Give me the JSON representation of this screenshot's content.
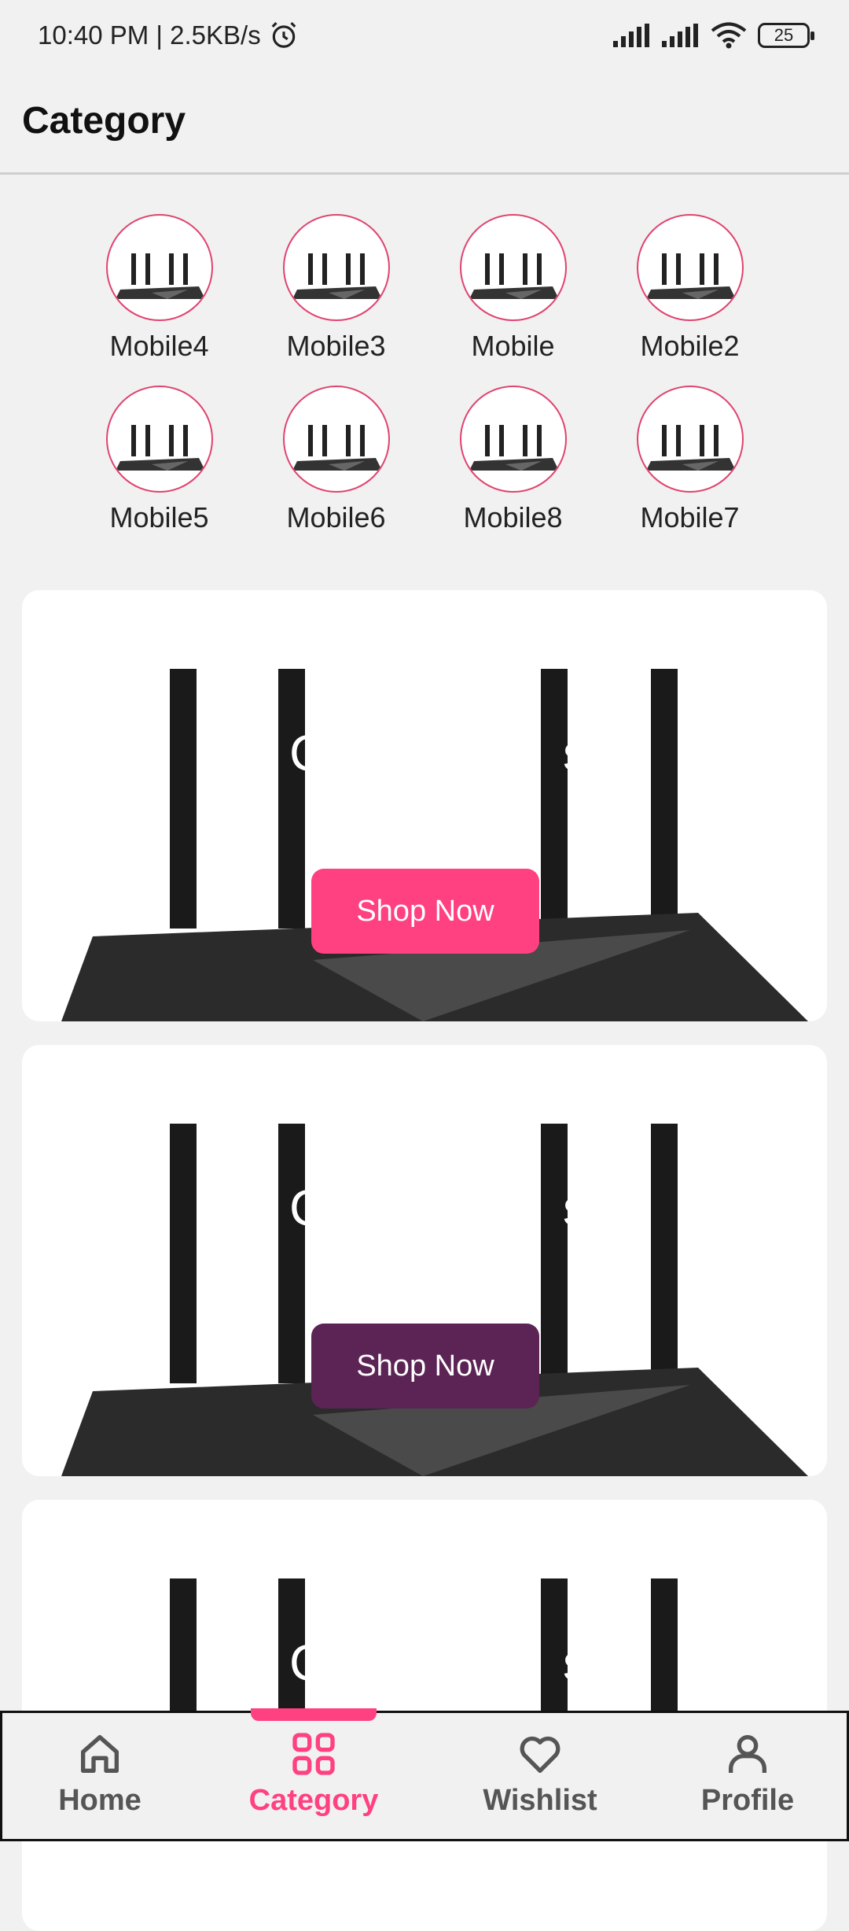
{
  "status": {
    "time_speed": "10:40 PM | 2.5KB/s",
    "battery": "25"
  },
  "header": {
    "title": "Category"
  },
  "categories": [
    {
      "label": "Mobile4"
    },
    {
      "label": "Mobile3"
    },
    {
      "label": "Mobile"
    },
    {
      "label": "Mobile2"
    },
    {
      "label": "Mobile5"
    },
    {
      "label": "Mobile6"
    },
    {
      "label": "Mobile8"
    },
    {
      "label": "Mobile7"
    }
  ],
  "banners": [
    {
      "title_left": "C",
      "title_right": "s",
      "button_label": "Shop Now",
      "button_color": "#ff4081"
    },
    {
      "title_left": "C",
      "title_right": "s",
      "button_label": "Shop Now",
      "button_color": "#5c2455"
    },
    {
      "title_left": "C",
      "title_right": "s"
    }
  ],
  "nav": {
    "active_color": "#ff4081",
    "inactive_color": "#555555",
    "items": [
      {
        "label": "Home",
        "icon": "home-icon"
      },
      {
        "label": "Category",
        "icon": "category-icon"
      },
      {
        "label": "Wishlist",
        "icon": "heart-icon"
      },
      {
        "label": "Profile",
        "icon": "person-icon"
      }
    ]
  }
}
